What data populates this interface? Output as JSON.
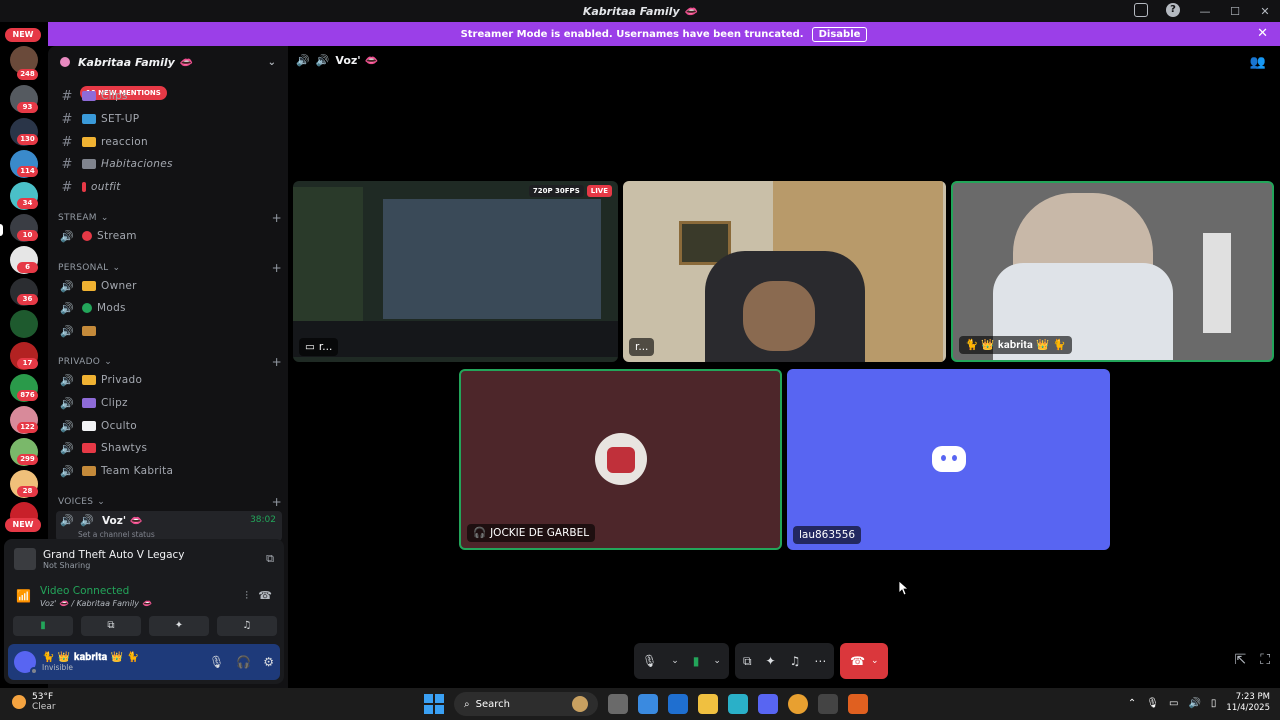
{
  "window": {
    "title": "Kabritaa Family 👄",
    "controls": [
      "—",
      "☐",
      "✕"
    ]
  },
  "banner": {
    "message": "Streamer Mode is enabled. Usernames have been truncated.",
    "disable_label": "Disable"
  },
  "rail": {
    "badges": [
      "NEW",
      "248",
      "93",
      "130",
      "114",
      "34",
      "10",
      "6",
      "36",
      "17",
      "876",
      "122",
      "299",
      "28",
      "NEW"
    ]
  },
  "server": {
    "name": "Kabritaa Family 👄",
    "mentions_label": "10 NEW MENTIONS"
  },
  "channels": {
    "text": [
      {
        "label": "Clips"
      },
      {
        "label": "SET-UP"
      },
      {
        "label": "reaccion"
      },
      {
        "label": "Habitaciones"
      },
      {
        "label": "outfit"
      }
    ],
    "categories": [
      {
        "name": "STREAM",
        "channels": [
          {
            "label": "Stream",
            "color": "#e63946"
          }
        ]
      },
      {
        "name": "PERSONAL",
        "channels": [
          {
            "label": "Owner",
            "color": "#f0b232"
          },
          {
            "label": "Mods",
            "color": "#23a55a"
          },
          {
            "label": "",
            "color": "#c48a3a"
          }
        ]
      },
      {
        "name": "PRIVADO",
        "channels": [
          {
            "label": "Privado",
            "color": "#f0b232"
          },
          {
            "label": "Clipz",
            "color": "#8e6bd8"
          },
          {
            "label": "Oculto",
            "color": "#f2f3f5"
          },
          {
            "label": "Shawtys",
            "color": "#e63946"
          },
          {
            "label": "Team Kabrita",
            "color": "#c48a3a"
          }
        ]
      }
    ],
    "voices_category": "VOICES",
    "active_voice": {
      "label": "Voz' 👄",
      "timer": "38:02",
      "status_hint": "Set a channel status"
    }
  },
  "activity": {
    "game_title": "Grand Theft Auto V Legacy",
    "game_status": "Not Sharing"
  },
  "voice_status": {
    "title": "Video Connected",
    "location": "Voz' 👄 / Kabritaa Family 👄"
  },
  "user": {
    "name": "🐈 👑 𝐤𝐚𝐛𝐫𝐢𝐭𝐚 👑 🐈",
    "status": "Invisible"
  },
  "voice_header": {
    "channel": "Voz' 👄"
  },
  "tiles": {
    "stream": {
      "name": "r...",
      "quality": "720P 30FPS",
      "live": "LIVE"
    },
    "cam1": {
      "name": "r..."
    },
    "cam2": {
      "name": "🐈 👑 𝐤𝐚𝐛𝐫𝐢𝐭𝐚 👑 🐈"
    },
    "bot": {
      "name": "JOCKIE DE GARBEL"
    },
    "user": {
      "name": "lau863556"
    }
  },
  "taskbar": {
    "temp": "53°F",
    "condition": "Clear",
    "search_placeholder": "Search",
    "time": "7:23 PM",
    "date": "11/4/2025"
  },
  "colors": {
    "banner": "#9b3fe8",
    "hangup": "#da373c",
    "connected": "#23a55a",
    "discord_blurple": "#5865f2"
  }
}
